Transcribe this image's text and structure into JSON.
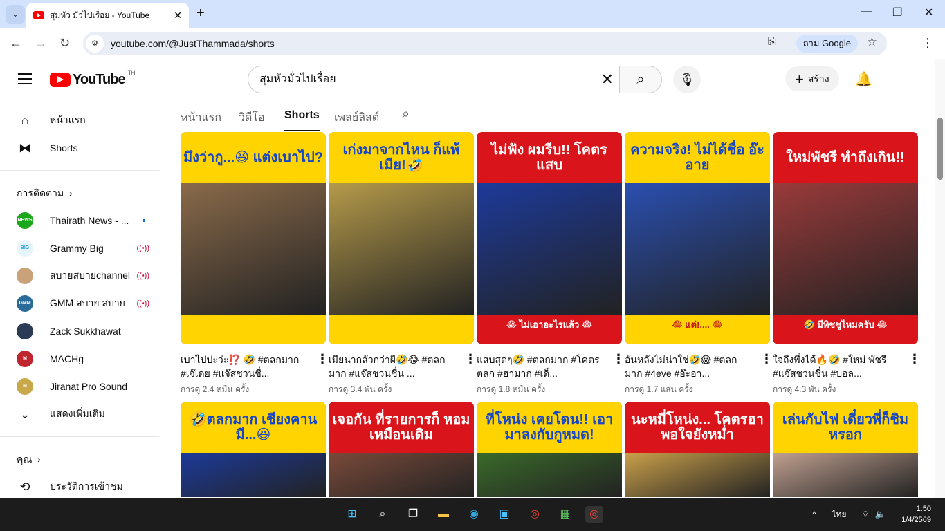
{
  "browser": {
    "tab_title": "สุมหัว มั่วไปเรื่อย - YouTube",
    "url": "youtube.com/@JustThammada/shorts",
    "ask_google": "ถาม Google"
  },
  "masthead": {
    "logo": "YouTube",
    "region": "TH",
    "search_value": "สุมหัวมั่วไปเรื่อย",
    "create_label": "สร้าง"
  },
  "sidebar": {
    "main": [
      {
        "label": "หน้าแรก",
        "icon": "home-icon"
      },
      {
        "label": "Shorts",
        "icon": "shorts-icon"
      }
    ],
    "subs_header": "การติดตาม",
    "subscriptions": [
      {
        "name": "Thairath News - ...",
        "status": "new",
        "color": "#1aa81a",
        "abbr": "NEWS"
      },
      {
        "name": "Grammy Big",
        "status": "live",
        "color": "#e6f4fb",
        "abbr": "BIG"
      },
      {
        "name": "สบายสบายchannel",
        "status": "live",
        "color": "#c9a27a",
        "abbr": ""
      },
      {
        "name": "GMM สบาย สบาย",
        "status": "live",
        "color": "#2a6b9a",
        "abbr": "GMM"
      },
      {
        "name": "Zack Sukkhawat",
        "status": "",
        "color": "#2b3a55",
        "abbr": ""
      },
      {
        "name": "MACHg",
        "status": "",
        "color": "#c0262d",
        "abbr": "M"
      },
      {
        "name": "Jiranat Pro Sound",
        "status": "",
        "color": "#c9a84a",
        "abbr": "M"
      }
    ],
    "show_more": "แสดงเพิ่มเติม",
    "you_header": "คุณ",
    "history": "ประวัติการเข้าชม"
  },
  "channel_tabs": [
    "หน้าแรก",
    "วิดีโอ",
    "Shorts",
    "เพลย์ลิสต์"
  ],
  "shorts": [
    {
      "thumb_top": "มึงว่ากู...😆 แต่งเบาไป?",
      "thumb_bottom": "",
      "top_style": "yellow",
      "title": "เบาไปปะว่ะ⁉️ 🤣 #ตลกมาก #เจ๊เดย #แจ๊สชวนชื่...",
      "views": "การดู 2.4 หมื่น ครั้ง",
      "mid": "#8a6a4a"
    },
    {
      "thumb_top": "เก่งมาจากไหน ก็แพ้เมีย!🤣",
      "thumb_bottom": "",
      "top_style": "yellow",
      "title": "เมียน่ากลัวกว่าผี🤣😂 #ตลกมาก #แจ๊สชวนชื่น ...",
      "views": "การดู 3.4 พัน ครั้ง",
      "mid": "#b59a4a"
    },
    {
      "thumb_top": "ไม่ฟัง ผมรีบ!! โคตรแสบ",
      "thumb_bottom": "😂 ไม่เอาอะไรแล้ว 😂",
      "top_style": "red",
      "title": "แสบสุดๆ🤣 #ตลกมาก #โคตรตลก #ฮามาก #เด็...",
      "views": "การดู 1.8 หมื่น ครั้ง",
      "mid": "#1d3a9a"
    },
    {
      "thumb_top": "ความจริง! ไม่ได้ชื่อ อ๊ะอาย",
      "thumb_bottom": "😂 แต่!.... 😂",
      "top_style": "yellow",
      "title": "อันหลังไม่น่าใช่🤣😱 #ตลกมาก #4eve #อ๊ะอา...",
      "views": "การดู 1.7 แสน ครั้ง",
      "mid": "#2a4fb0"
    },
    {
      "thumb_top": "ใหม่พัชรี ทำถึงเกิน!!",
      "thumb_bottom": "🤣 มีทิชชูไหมครับ 😂",
      "top_style": "red",
      "title": "ใจถึงพึ่งได้🔥🤣 #ใหม่ พัชรี #แจ๊สชวนชื่น #บอล...",
      "views": "การดู 4.3 พัน ครั้ง",
      "mid": "#9a3a3a"
    },
    {
      "thumb_top": "🤣ตลกมาก เชียงคานมี...😆",
      "thumb_bottom": "",
      "top_style": "yellow",
      "title": "",
      "views": "",
      "mid": "#1d3a9a"
    },
    {
      "thumb_top": "เจอกัน ที่รายการก็ หอมเหมือนเดิม",
      "thumb_bottom": "",
      "top_style": "red",
      "title": "",
      "views": "",
      "mid": "#7a4a3a"
    },
    {
      "thumb_top": "ที่โหน่ง เคยโดน!! เอามาลงกับกูหมด!",
      "thumb_bottom": "",
      "top_style": "yellow",
      "title": "",
      "views": "",
      "mid": "#3a6a2a"
    },
    {
      "thumb_top": "นะหมี่โหน่ง... โคตรฮา พอใจยังหม่ำ",
      "thumb_bottom": "",
      "top_style": "red",
      "title": "",
      "views": "",
      "mid": "#caa04a"
    },
    {
      "thumb_top": "เล่นกับไฟ เดี๋ยวพี่ก็ชิมหรอก",
      "thumb_bottom": "",
      "top_style": "yellow",
      "title": "",
      "views": "",
      "mid": "#c0a090"
    }
  ],
  "taskbar": {
    "lang": "ไทย",
    "time": "1:50",
    "date": "1/4/2569"
  }
}
